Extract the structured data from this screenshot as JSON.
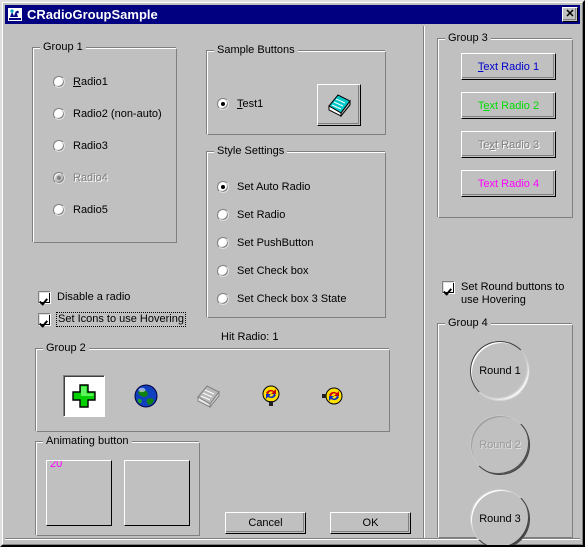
{
  "window": {
    "title": "CRadioGroupSample",
    "icon": "app-icon",
    "close_label": "✕"
  },
  "group1": {
    "title": "Group 1",
    "items": [
      {
        "label": "Radio1",
        "accel": "R",
        "checked": false,
        "disabled": false
      },
      {
        "label": "Radio2 (non-auto)",
        "accel": "",
        "checked": false,
        "disabled": false
      },
      {
        "label": "Radio3",
        "accel": "",
        "checked": false,
        "disabled": false
      },
      {
        "label": "Radio4",
        "accel": "",
        "checked": true,
        "disabled": true
      },
      {
        "label": "Radio5",
        "accel": "",
        "checked": false,
        "disabled": false
      }
    ]
  },
  "sample_buttons": {
    "title": "Sample Buttons",
    "radio": {
      "label": "Test1",
      "accel": "T",
      "checked": true
    },
    "icon_button": "book-icon"
  },
  "style_settings": {
    "title": "Style Settings",
    "items": [
      {
        "label": "Set Auto Radio",
        "checked": true
      },
      {
        "label": "Set Radio",
        "checked": false
      },
      {
        "label": "Set PushButton",
        "checked": false
      },
      {
        "label": "Set Check box",
        "checked": false
      },
      {
        "label": "Set Check box 3 State",
        "checked": false
      }
    ]
  },
  "hit_status": "Hit Radio: 1",
  "checkboxes": {
    "disable_radio": {
      "label": "Disable a radio",
      "checked": true,
      "focused": false
    },
    "icons_hovering": {
      "label": "Set Icons to use Hovering",
      "checked": true,
      "focused": true
    },
    "round_hovering": {
      "label": "Set Round buttons to use Hovering",
      "checked": true,
      "focused": false
    }
  },
  "group2": {
    "title": "Group 2",
    "buttons": [
      {
        "icon": "green-cross-icon",
        "state": "pressed"
      },
      {
        "icon": "globe-icon",
        "state": "normal"
      },
      {
        "icon": "book-disabled-icon",
        "state": "disabled"
      },
      {
        "icon": "yellow-bulb-arrows-icon",
        "state": "normal"
      },
      {
        "icon": "yellow-circle-arrows-icon",
        "state": "normal"
      }
    ]
  },
  "animating": {
    "title": "Animating button",
    "counter": "20",
    "counter_color": "#ff00ff"
  },
  "group3": {
    "title": "Group 3",
    "buttons": [
      {
        "label": "Text Radio 1",
        "accel": "T",
        "color": "#0000cd",
        "disabled": false
      },
      {
        "label": "Text Radio 2",
        "accel": "e",
        "color": "#00dd00",
        "disabled": false
      },
      {
        "label": "Text Radio 3",
        "accel": "x",
        "color": "#c0c0c0",
        "disabled": true
      },
      {
        "label": "Text Radio 4",
        "accel": "",
        "color": "#ff00ff",
        "disabled": false
      }
    ]
  },
  "group4": {
    "title": "Group 4",
    "buttons": [
      {
        "label": "Round 1",
        "state": "raised"
      },
      {
        "label": "Round 2",
        "state": "disabled"
      },
      {
        "label": "Round 3",
        "state": "raised"
      }
    ]
  },
  "dialog_buttons": {
    "cancel": "Cancel",
    "ok": "OK"
  }
}
